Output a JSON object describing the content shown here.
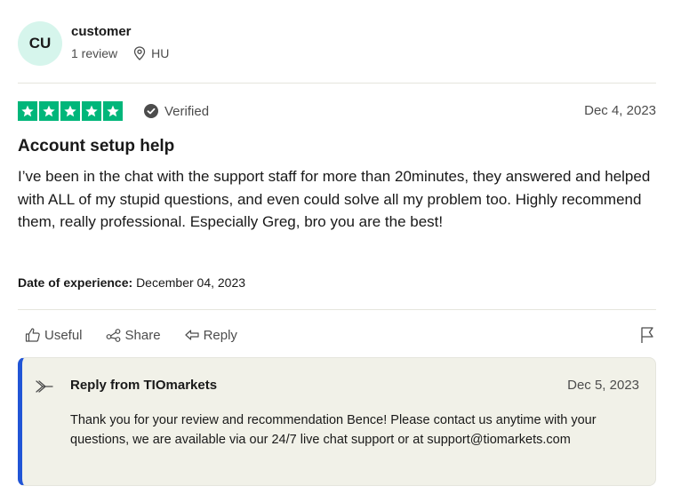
{
  "reviewer": {
    "initials": "CU",
    "name": "customer",
    "review_count": "1 review",
    "country": "HU"
  },
  "review": {
    "rating": 5,
    "rating_color": "#00b67a",
    "verified_label": "Verified",
    "date": "Dec 4, 2023",
    "title": "Account setup help",
    "body": "I’ve been in the chat with the support staff for more than 20minutes, they answered and helped with ALL of my stupid questions, and even could solve all my problem too. Highly recommend them, really professional. Especially Greg, bro you are the best!",
    "experience_label": "Date of experience:",
    "experience_date": "December 04, 2023"
  },
  "actions": {
    "useful": "Useful",
    "share": "Share",
    "reply": "Reply"
  },
  "company_reply": {
    "from": "Reply from TIOmarkets",
    "date": "Dec 5, 2023",
    "text": "Thank you for your review and recommendation Bence! Please contact us anytime with your questions, we are available via our 24/7 live chat support or at support@tiomarkets.com",
    "accent_color": "#2155d6"
  }
}
